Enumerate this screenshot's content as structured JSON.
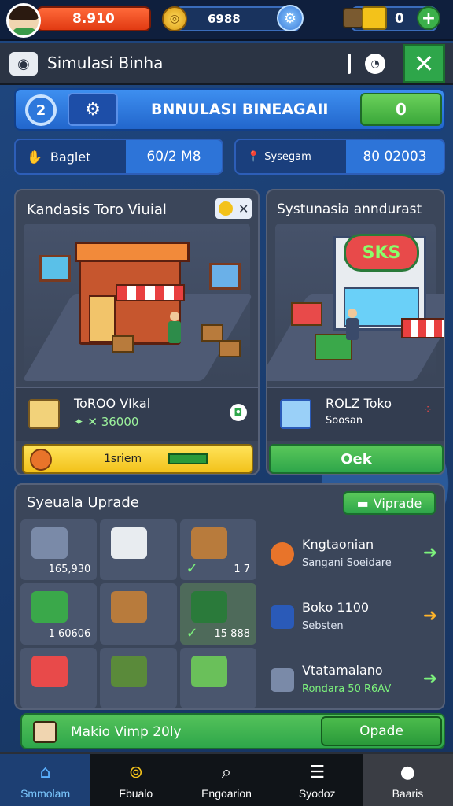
{
  "topbar": {
    "cash": "8.910",
    "coins": "6988",
    "gems": "0"
  },
  "window": {
    "title": "Simulasi Binha"
  },
  "header": {
    "title": "BNNULASI BINEAGAII",
    "score": "0"
  },
  "stats": [
    {
      "label": "Baglet",
      "value": "60/2 M8"
    },
    {
      "label": "Sysegam",
      "value": "80 02003"
    }
  ],
  "cards": [
    {
      "title": "Kandasis Toro Viuial",
      "product_name": "ToROO VIkal",
      "product_price": "36000",
      "bar_label": "1sriem"
    },
    {
      "title": "Systunasia anndurast",
      "product_name": "ROLZ Toko",
      "product_sub": "Soosan",
      "button_label": "Oek"
    }
  ],
  "upgrade": {
    "title": "Syeuala Uprade",
    "button_label": "Viprade",
    "grid": [
      {
        "value": "165,930"
      },
      {
        "value": ""
      },
      {
        "value": "1 7"
      },
      {
        "value": "1 60606"
      },
      {
        "value": ""
      },
      {
        "value": "15 888"
      },
      {
        "value": ""
      },
      {
        "value": ""
      },
      {
        "value": ""
      }
    ],
    "rows": [
      {
        "title": "Kngtaonian",
        "sub": "Sangani Soeidare"
      },
      {
        "title": "Boko 1100",
        "sub": "Sebsten"
      },
      {
        "title": "Vtatamalano",
        "sub": "Rondara 50 R6AV"
      }
    ]
  },
  "banner": {
    "text": "Makio Vimp 20ly",
    "button_label": "Opade"
  },
  "nav": [
    {
      "label": "Smmolam",
      "icon": "house-icon"
    },
    {
      "label": "Fbualo",
      "icon": "magnifier-gold-icon"
    },
    {
      "label": "Engoarion",
      "icon": "search-icon"
    },
    {
      "label": "Syodoz",
      "icon": "list-icon"
    },
    {
      "label": "Baaris",
      "icon": "user-icon"
    }
  ],
  "colors": {
    "accent_blue": "#2d74d8",
    "accent_green": "#2ea64a",
    "cash_red": "#e13a12",
    "panel": "#3b465a"
  }
}
